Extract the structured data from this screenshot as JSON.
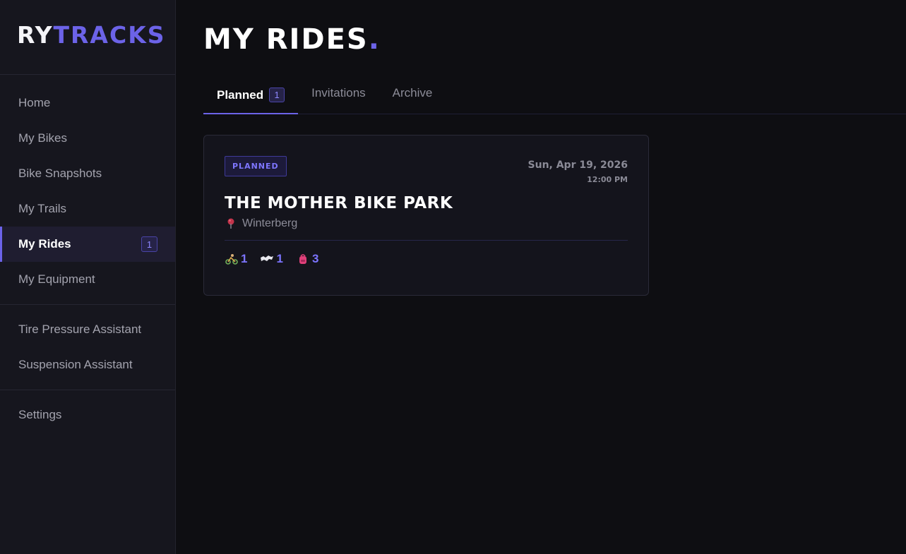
{
  "brand": {
    "part1": "RY",
    "part2": "TRACKS"
  },
  "sidebar": {
    "groups": [
      [
        {
          "label": "Home"
        },
        {
          "label": "My Bikes"
        },
        {
          "label": "Bike Snapshots"
        },
        {
          "label": "My Trails"
        },
        {
          "label": "My Rides",
          "badge": "1",
          "active": true
        },
        {
          "label": "My Equipment"
        }
      ],
      [
        {
          "label": "Tire Pressure Assistant"
        },
        {
          "label": "Suspension Assistant"
        }
      ],
      [
        {
          "label": "Settings"
        }
      ]
    ]
  },
  "page": {
    "title": "MY RIDES",
    "title_dot": "."
  },
  "tabs": [
    {
      "label": "Planned",
      "badge": "1",
      "active": true
    },
    {
      "label": "Invitations"
    },
    {
      "label": "Archive"
    }
  ],
  "ride": {
    "status": "PLANNED",
    "date": "Sun, Apr 19, 2026",
    "time": "12:00 PM",
    "title": "THE MOTHER BIKE PARK",
    "location": "Winterberg",
    "stats": [
      {
        "icon": "mountain-biker-icon",
        "value": "1"
      },
      {
        "icon": "trail-map-icon",
        "value": "1"
      },
      {
        "icon": "backpack-icon",
        "value": "3"
      }
    ]
  },
  "colors": {
    "accent": "#6c63e8",
    "background": "#0e0e12",
    "sidebar": "#16161e"
  }
}
